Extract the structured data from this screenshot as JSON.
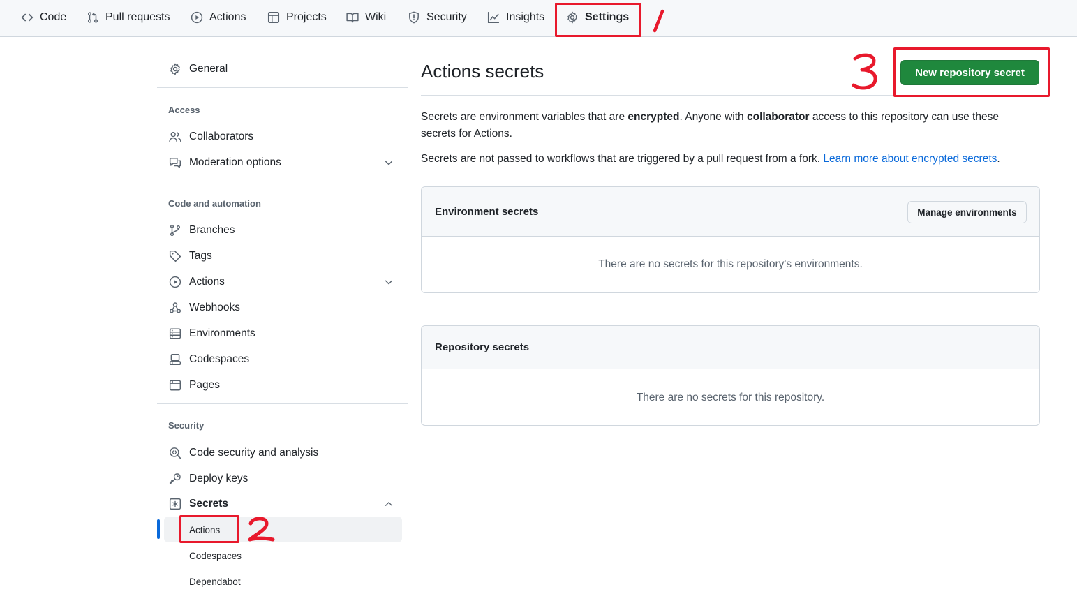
{
  "topnav": {
    "items": [
      {
        "label": "Code",
        "icon": "code-icon"
      },
      {
        "label": "Pull requests",
        "icon": "git-pull-request-icon"
      },
      {
        "label": "Actions",
        "icon": "play-icon"
      },
      {
        "label": "Projects",
        "icon": "table-icon"
      },
      {
        "label": "Wiki",
        "icon": "book-icon"
      },
      {
        "label": "Security",
        "icon": "shield-icon"
      },
      {
        "label": "Insights",
        "icon": "graph-icon"
      },
      {
        "label": "Settings",
        "icon": "gear-icon",
        "selected": true
      }
    ]
  },
  "sidebar": {
    "general": "General",
    "access_heading": "Access",
    "collaborators": "Collaborators",
    "moderation": "Moderation options",
    "code_heading": "Code and automation",
    "branches": "Branches",
    "tags": "Tags",
    "actions": "Actions",
    "webhooks": "Webhooks",
    "environments": "Environments",
    "codespaces": "Codespaces",
    "pages": "Pages",
    "security_heading": "Security",
    "code_security": "Code security and analysis",
    "deploy_keys": "Deploy keys",
    "secrets": "Secrets",
    "secrets_sub": {
      "actions": "Actions",
      "codespaces": "Codespaces",
      "dependabot": "Dependabot"
    }
  },
  "main": {
    "title": "Actions secrets",
    "new_secret_button": "New repository secret",
    "intro": {
      "p1_a": "Secrets are environment variables that are ",
      "p1_b": "encrypted",
      "p1_c": ". Anyone with ",
      "p1_d": "collaborator",
      "p1_e": " access to this repository can use these",
      "p1_f": "secrets for Actions.",
      "p2_a": "Secrets are not passed to workflows that are triggered by a pull request from a fork. ",
      "p2_link": "Learn more about encrypted secrets",
      "p2_end": "."
    },
    "environment_box": {
      "title": "Environment secrets",
      "button": "Manage environments",
      "empty": "There are no secrets for this repository's environments."
    },
    "repository_box": {
      "title": "Repository secrets",
      "empty": "There are no secrets for this repository."
    }
  },
  "colors": {
    "primary_green": "#1f883d",
    "link_blue": "#0969da",
    "annotation_red": "#e8192c",
    "selected_tab_underline": "#fd8c73"
  }
}
